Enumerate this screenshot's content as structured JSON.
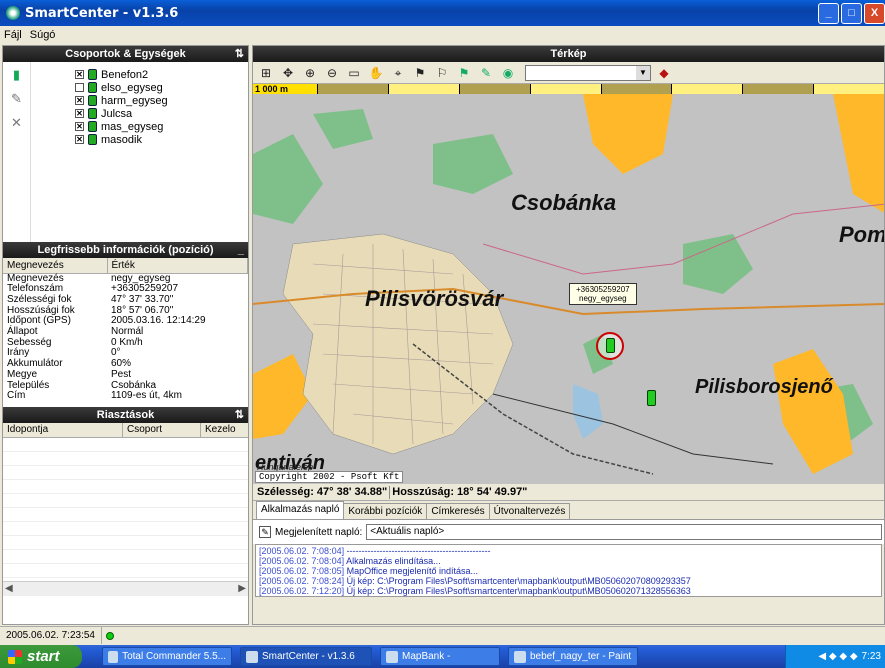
{
  "window": {
    "title": "SmartCenter - v1.3.6",
    "controls": [
      "_",
      "□",
      "X"
    ]
  },
  "menu": [
    "Fájl",
    "Súgó"
  ],
  "groups_panel": {
    "title": "Csoportok & Egységek",
    "items": [
      {
        "label": "Benefon2",
        "checked": true
      },
      {
        "label": "elso_egyseg",
        "checked": false
      },
      {
        "label": "harm_egyseg",
        "checked": true
      },
      {
        "label": "Julcsa",
        "checked": true
      },
      {
        "label": "mas_egyseg",
        "checked": true
      },
      {
        "label": "masodik",
        "checked": true
      }
    ]
  },
  "info_panel": {
    "title": "Legfrissebb információk (pozíció)",
    "col_name": "Megnevezés",
    "col_value": "Érték",
    "rows": [
      [
        "Megnevezés",
        "negy_egyseg"
      ],
      [
        "Telefonszám",
        "+36305259207"
      ],
      [
        "Szélességi fok",
        "47° 37' 33.70\""
      ],
      [
        "Hosszúsági fok",
        "18° 57' 06.70\""
      ],
      [
        "Időpont (GPS)",
        "2005.03.16. 12:14:29"
      ],
      [
        "Állapot",
        "Normál"
      ],
      [
        "Sebesség",
        "0 Km/h"
      ],
      [
        "Irány",
        "0°"
      ],
      [
        "Akkumulátor",
        "60%"
      ],
      [
        "Megye",
        "Pest"
      ],
      [
        "Település",
        "Csobánka"
      ],
      [
        "Cím",
        "1109-es út, 4km"
      ]
    ]
  },
  "alarms_panel": {
    "title": "Riasztások",
    "columns": [
      "Idopontja",
      "Csoport",
      "Kezelo"
    ]
  },
  "map_panel": {
    "title": "Térkép",
    "scale": "1 000 m",
    "labels": {
      "csobanka": "Csobánka",
      "pilisvorosvar": "Pilisvörösvár",
      "pilisborosjeno": "Pilisborosjenő",
      "pom": "Pom",
      "entivan": "entiván",
      "hungariatelep": "Hungáriatelep"
    },
    "tooltip_phone": "+36305259207",
    "tooltip_unit": "negy_egyseg",
    "copyright": "Copyright 2002 - Psoft Kft",
    "lat_label": "Szélesség: 47° 38' 34.88\"",
    "lon_label": "Hosszúság: 18° 54' 49.97\""
  },
  "tabs": [
    "Alkalmazás napló",
    "Korábbi pozíciók",
    "Címkeresés",
    "Útvonaltervezés"
  ],
  "log": {
    "label": "Megjelenített napló:",
    "selected": "<Aktuális napló>",
    "lines": [
      [
        "[2005.06.02. 7:08:04]",
        "------------------------------------------------"
      ],
      [
        "[2005.06.02. 7:08:04]",
        "Alkalmazás elindítása..."
      ],
      [
        "[2005.06.02. 7:08:05]",
        "MapOffice megjelenítő indítása..."
      ],
      [
        "[2005.06.02. 7:08:24]",
        "Új kép: C:\\Program Files\\Psoft\\smartcenter\\mapbank\\output\\MB050602070809293357"
      ],
      [
        "[2005.06.02. 7:12:20]",
        "Új kép: C:\\Program Files\\Psoft\\smartcenter\\mapbank\\output\\MB050602071328556363"
      ]
    ]
  },
  "status": {
    "time": "2005.06.02. 7:23:54"
  },
  "taskbar": {
    "start": "start",
    "tasks": [
      "Total Commander 5.5...",
      "SmartCenter - v1.3.6",
      "MapBank -",
      "bebef_nagy_ter - Paint"
    ],
    "clock": "7:23"
  }
}
